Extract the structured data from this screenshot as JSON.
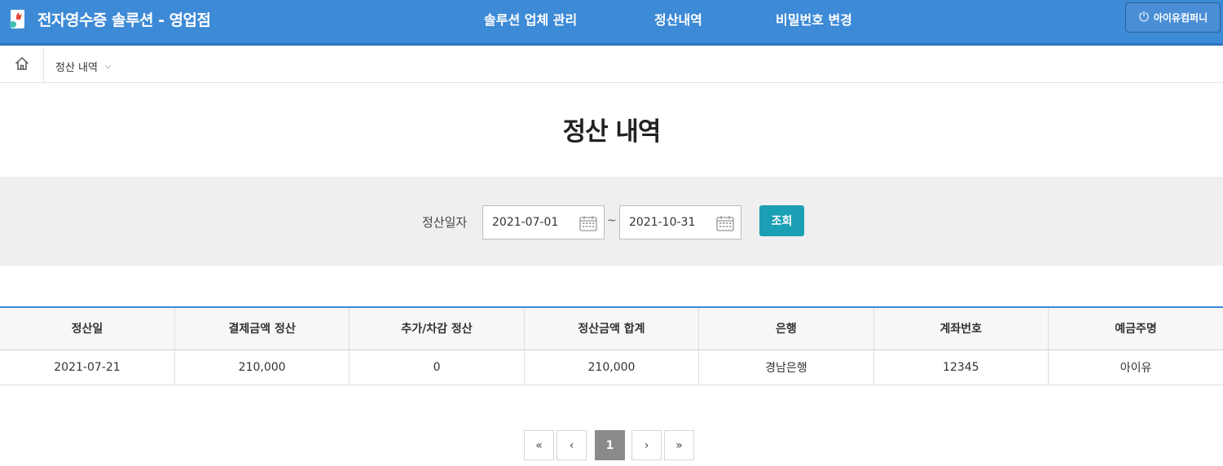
{
  "header": {
    "title": "전자영수증 솔루션 - 영업점",
    "nav": [
      "솔루션 업체 관리",
      "정산내역",
      "비밀번호 변경"
    ],
    "user_label": "아이유컴퍼니"
  },
  "breadcrumb": {
    "current": "정산 내역"
  },
  "page_title": "정산 내역",
  "search": {
    "label": "정산일자",
    "date_from": "2021-07-01",
    "date_to": "2021-10-31",
    "separator": "~",
    "button": "조회"
  },
  "table": {
    "columns": [
      "정산일",
      "결제금액 정산",
      "추가/차감 정산",
      "정산금액 합계",
      "은행",
      "계좌번호",
      "예금주명"
    ],
    "rows": [
      [
        "2021-07-21",
        "210,000",
        "0",
        "210,000",
        "경남은행",
        "12345",
        "아이유"
      ]
    ]
  },
  "pagination": {
    "first": "«",
    "prev": "‹",
    "current": "1",
    "next": "›",
    "last": "»"
  },
  "colors": {
    "header": "#3d8ad6",
    "accent": "#1a9fb4",
    "search_bg": "#efefef"
  }
}
